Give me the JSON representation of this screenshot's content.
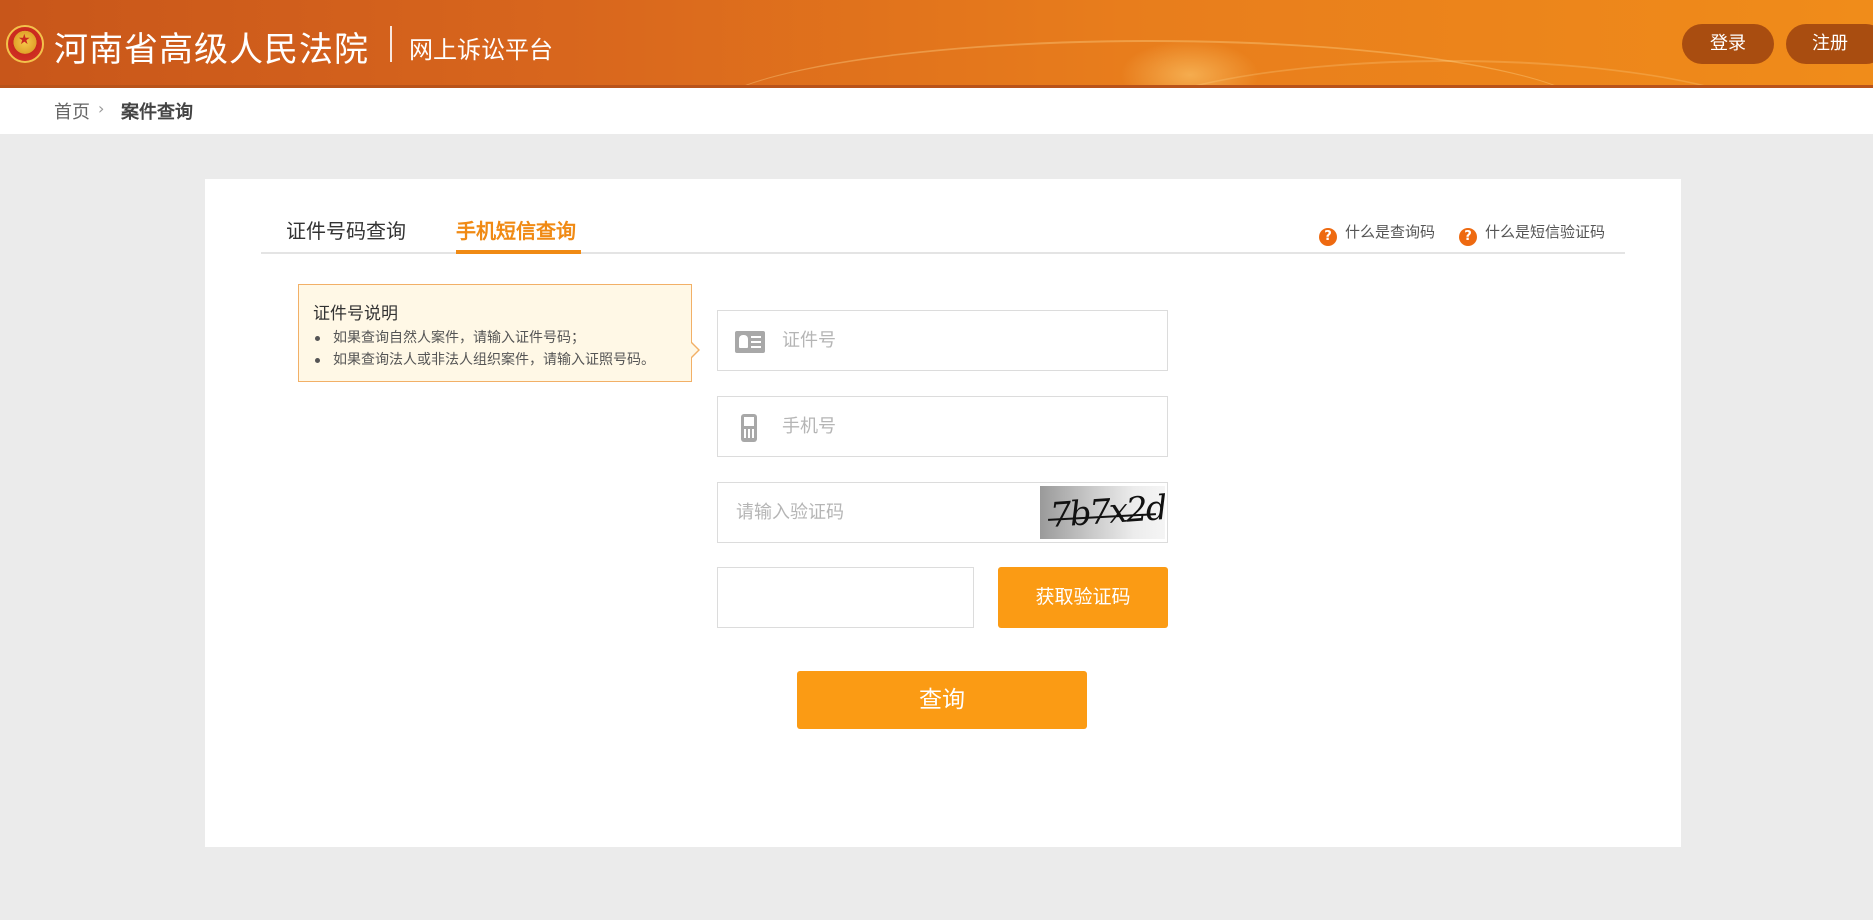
{
  "header": {
    "title": "河南省高级人民法院",
    "subtitle": "网上诉讼平台",
    "login_label": "登录",
    "register_label": "注册",
    "brand_colors": {
      "header_start": "#c8561a",
      "header_end": "#f08c1a"
    }
  },
  "breadcrumb": {
    "home": "首页",
    "separator": "›",
    "current": "案件查询"
  },
  "tabs": [
    {
      "label": "证件号码查询",
      "active": false
    },
    {
      "label": "手机短信查询",
      "active": true
    }
  ],
  "help_links": [
    {
      "label": "什么是查询码",
      "icon": "?"
    },
    {
      "label": "什么是短信验证码",
      "icon": "?"
    }
  ],
  "tip": {
    "title": "证件号说明",
    "items": [
      "如果查询自然人案件，请输入证件号码；",
      "如果查询法人或非法人组织案件，请输入证照号码。"
    ]
  },
  "form": {
    "id_placeholder": "证件号",
    "phone_placeholder": "手机号",
    "captcha_placeholder": "请输入验证码",
    "captcha_text": "7b7x2d",
    "sms_code_value": "",
    "get_code_label": "获取验证码",
    "submit_label": "查询"
  },
  "accent_color": "#fb9b14",
  "active_tab_color": "#f08a14"
}
